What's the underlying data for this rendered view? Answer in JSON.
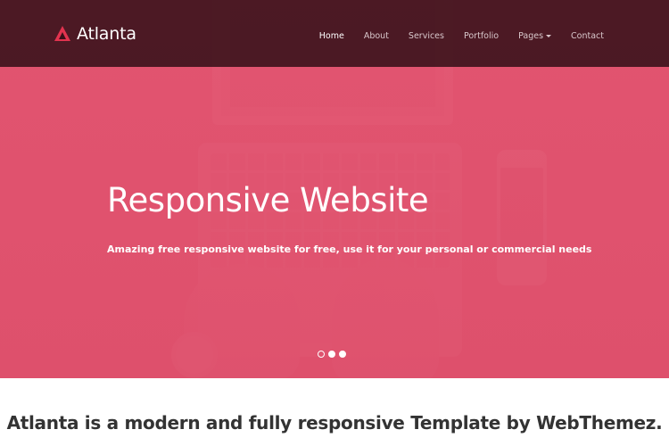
{
  "brand": {
    "name": "Atlanta",
    "icon": "triangle-logo-icon",
    "color": "#e2334f"
  },
  "nav": {
    "items": [
      {
        "label": "Home",
        "active": true
      },
      {
        "label": "About",
        "active": false
      },
      {
        "label": "Services",
        "active": false
      },
      {
        "label": "Portfolio",
        "active": false
      },
      {
        "label": "Pages",
        "active": false,
        "dropdown": true
      },
      {
        "label": "Contact",
        "active": false
      }
    ]
  },
  "hero": {
    "title": "Responsive Website",
    "subtitle": "Amazing free responsive website for free, use it for your personal or commercial needs",
    "overlay_color": "#e25470",
    "slides": 3,
    "active_slide": 1
  },
  "intro": {
    "text": "Atlanta is a modern and fully responsive Template by WebThemez."
  }
}
